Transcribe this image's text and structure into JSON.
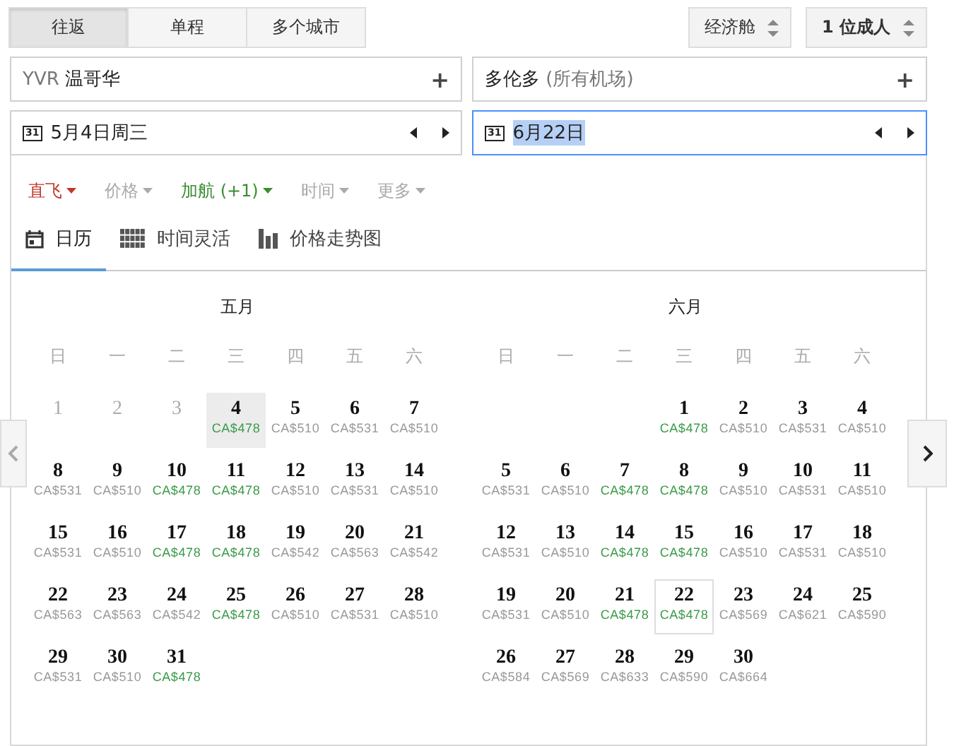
{
  "trip_types": [
    {
      "label": "往返",
      "selected": true
    },
    {
      "label": "单程",
      "selected": false
    },
    {
      "label": "多个城市",
      "selected": false
    }
  ],
  "cabin": {
    "label": "经济舱"
  },
  "passengers": {
    "label": "1 位成人"
  },
  "origin": {
    "code": "YVR",
    "city": "温哥华",
    "plus": "+"
  },
  "destination": {
    "city": "多伦多",
    "note": "(所有机场)",
    "plus": "+"
  },
  "depart_date": {
    "value": "5月4日周三",
    "icon": "31",
    "focused": false
  },
  "return_date": {
    "value": "6月22日",
    "icon": "31",
    "focused": true
  },
  "filters": [
    {
      "label": "直飞",
      "kind": "active"
    },
    {
      "label": "价格",
      "kind": "idle"
    },
    {
      "label": "加航 (+1)",
      "kind": "set"
    },
    {
      "label": "时间",
      "kind": "idle"
    },
    {
      "label": "更多",
      "kind": "idle"
    }
  ],
  "views": [
    {
      "label": "日历",
      "kind": "calendar",
      "selected": true
    },
    {
      "label": "时间灵活",
      "kind": "grid",
      "selected": false
    },
    {
      "label": "价格走势图",
      "kind": "bars",
      "selected": false
    }
  ],
  "months": [
    {
      "title": "五月",
      "kind": "depart",
      "weekdays": [
        "日",
        "一",
        "二",
        "三",
        "四",
        "五",
        "六"
      ],
      "weeks": [
        [
          {
            "day": "1",
            "disabled": true,
            "selected": false
          },
          {
            "day": "2",
            "disabled": true,
            "selected": false
          },
          {
            "day": "3",
            "disabled": true,
            "selected": false
          },
          {
            "day": "4",
            "price": "CA$478",
            "disabled": false,
            "lowest": true,
            "selected": true
          },
          {
            "day": "5",
            "price": "CA$510",
            "disabled": false,
            "lowest": false,
            "selected": false
          },
          {
            "day": "6",
            "price": "CA$531",
            "disabled": false,
            "lowest": false,
            "selected": false
          },
          {
            "day": "7",
            "price": "CA$510",
            "disabled": false,
            "lowest": false,
            "selected": false
          }
        ],
        [
          {
            "day": "8",
            "price": "CA$531",
            "disabled": false,
            "lowest": false,
            "selected": false
          },
          {
            "day": "9",
            "price": "CA$510",
            "disabled": false,
            "lowest": false,
            "selected": false
          },
          {
            "day": "10",
            "price": "CA$478",
            "disabled": false,
            "lowest": true,
            "selected": false
          },
          {
            "day": "11",
            "price": "CA$478",
            "disabled": false,
            "lowest": true,
            "selected": false
          },
          {
            "day": "12",
            "price": "CA$510",
            "disabled": false,
            "lowest": false,
            "selected": false
          },
          {
            "day": "13",
            "price": "CA$531",
            "disabled": false,
            "lowest": false,
            "selected": false
          },
          {
            "day": "14",
            "price": "CA$510",
            "disabled": false,
            "lowest": false,
            "selected": false
          }
        ],
        [
          {
            "day": "15",
            "price": "CA$531",
            "disabled": false,
            "lowest": false,
            "selected": false
          },
          {
            "day": "16",
            "price": "CA$510",
            "disabled": false,
            "lowest": false,
            "selected": false
          },
          {
            "day": "17",
            "price": "CA$478",
            "disabled": false,
            "lowest": true,
            "selected": false
          },
          {
            "day": "18",
            "price": "CA$478",
            "disabled": false,
            "lowest": true,
            "selected": false
          },
          {
            "day": "19",
            "price": "CA$542",
            "disabled": false,
            "lowest": false,
            "selected": false
          },
          {
            "day": "20",
            "price": "CA$563",
            "disabled": false,
            "lowest": false,
            "selected": false
          },
          {
            "day": "21",
            "price": "CA$542",
            "disabled": false,
            "lowest": false,
            "selected": false
          }
        ],
        [
          {
            "day": "22",
            "price": "CA$563",
            "disabled": false,
            "lowest": false,
            "selected": false
          },
          {
            "day": "23",
            "price": "CA$563",
            "disabled": false,
            "lowest": false,
            "selected": false
          },
          {
            "day": "24",
            "price": "CA$542",
            "disabled": false,
            "lowest": false,
            "selected": false
          },
          {
            "day": "25",
            "price": "CA$478",
            "disabled": false,
            "lowest": true,
            "selected": false
          },
          {
            "day": "26",
            "price": "CA$510",
            "disabled": false,
            "lowest": false,
            "selected": false
          },
          {
            "day": "27",
            "price": "CA$531",
            "disabled": false,
            "lowest": false,
            "selected": false
          },
          {
            "day": "28",
            "price": "CA$510",
            "disabled": false,
            "lowest": false,
            "selected": false
          }
        ],
        [
          {
            "day": "29",
            "price": "CA$531",
            "disabled": false,
            "lowest": false,
            "selected": false
          },
          {
            "day": "30",
            "price": "CA$510",
            "disabled": false,
            "lowest": false,
            "selected": false
          },
          {
            "day": "31",
            "price": "CA$478",
            "disabled": false,
            "lowest": true,
            "selected": false
          }
        ]
      ]
    },
    {
      "title": "六月",
      "kind": "return",
      "weekdays": [
        "日",
        "一",
        "二",
        "三",
        "四",
        "五",
        "六"
      ],
      "weeks": [
        [
          {
            "day": "1",
            "price": "CA$478",
            "disabled": false,
            "lowest": true,
            "selected": false
          },
          {
            "day": "2",
            "price": "CA$510",
            "disabled": false,
            "lowest": false,
            "selected": false
          },
          {
            "day": "3",
            "price": "CA$531",
            "disabled": false,
            "lowest": false,
            "selected": false
          },
          {
            "day": "4",
            "price": "CA$510",
            "disabled": false,
            "lowest": false,
            "selected": false
          }
        ],
        [
          {
            "day": "5",
            "price": "CA$531",
            "disabled": false,
            "lowest": false,
            "selected": false
          },
          {
            "day": "6",
            "price": "CA$510",
            "disabled": false,
            "lowest": false,
            "selected": false
          },
          {
            "day": "7",
            "price": "CA$478",
            "disabled": false,
            "lowest": true,
            "selected": false
          },
          {
            "day": "8",
            "price": "CA$478",
            "disabled": false,
            "lowest": true,
            "selected": false
          },
          {
            "day": "9",
            "price": "CA$510",
            "disabled": false,
            "lowest": false,
            "selected": false
          },
          {
            "day": "10",
            "price": "CA$531",
            "disabled": false,
            "lowest": false,
            "selected": false
          },
          {
            "day": "11",
            "price": "CA$510",
            "disabled": false,
            "lowest": false,
            "selected": false
          }
        ],
        [
          {
            "day": "12",
            "price": "CA$531",
            "disabled": false,
            "lowest": false,
            "selected": false
          },
          {
            "day": "13",
            "price": "CA$510",
            "disabled": false,
            "lowest": false,
            "selected": false
          },
          {
            "day": "14",
            "price": "CA$478",
            "disabled": false,
            "lowest": true,
            "selected": false
          },
          {
            "day": "15",
            "price": "CA$478",
            "disabled": false,
            "lowest": true,
            "selected": false
          },
          {
            "day": "16",
            "price": "CA$510",
            "disabled": false,
            "lowest": false,
            "selected": false
          },
          {
            "day": "17",
            "price": "CA$531",
            "disabled": false,
            "lowest": false,
            "selected": false
          },
          {
            "day": "18",
            "price": "CA$510",
            "disabled": false,
            "lowest": false,
            "selected": false
          }
        ],
        [
          {
            "day": "19",
            "price": "CA$531",
            "disabled": false,
            "lowest": false,
            "selected": false
          },
          {
            "day": "20",
            "price": "CA$510",
            "disabled": false,
            "lowest": false,
            "selected": false
          },
          {
            "day": "21",
            "price": "CA$478",
            "disabled": false,
            "lowest": true,
            "selected": false
          },
          {
            "day": "22",
            "price": "CA$478",
            "disabled": false,
            "lowest": true,
            "selected": true
          },
          {
            "day": "23",
            "price": "CA$569",
            "disabled": false,
            "lowest": false,
            "selected": false
          },
          {
            "day": "24",
            "price": "CA$621",
            "disabled": false,
            "lowest": false,
            "selected": false
          },
          {
            "day": "25",
            "price": "CA$590",
            "disabled": false,
            "lowest": false,
            "selected": false
          }
        ],
        [
          {
            "day": "26",
            "price": "CA$584",
            "disabled": false,
            "lowest": false,
            "selected": false
          },
          {
            "day": "27",
            "price": "CA$569",
            "disabled": false,
            "lowest": false,
            "selected": false
          },
          {
            "day": "28",
            "price": "CA$633",
            "disabled": false,
            "lowest": false,
            "selected": false
          },
          {
            "day": "29",
            "price": "CA$590",
            "disabled": false,
            "lowest": false,
            "selected": false
          },
          {
            "day": "30",
            "price": "CA$664",
            "disabled": false,
            "lowest": false,
            "selected": false
          }
        ]
      ]
    }
  ]
}
